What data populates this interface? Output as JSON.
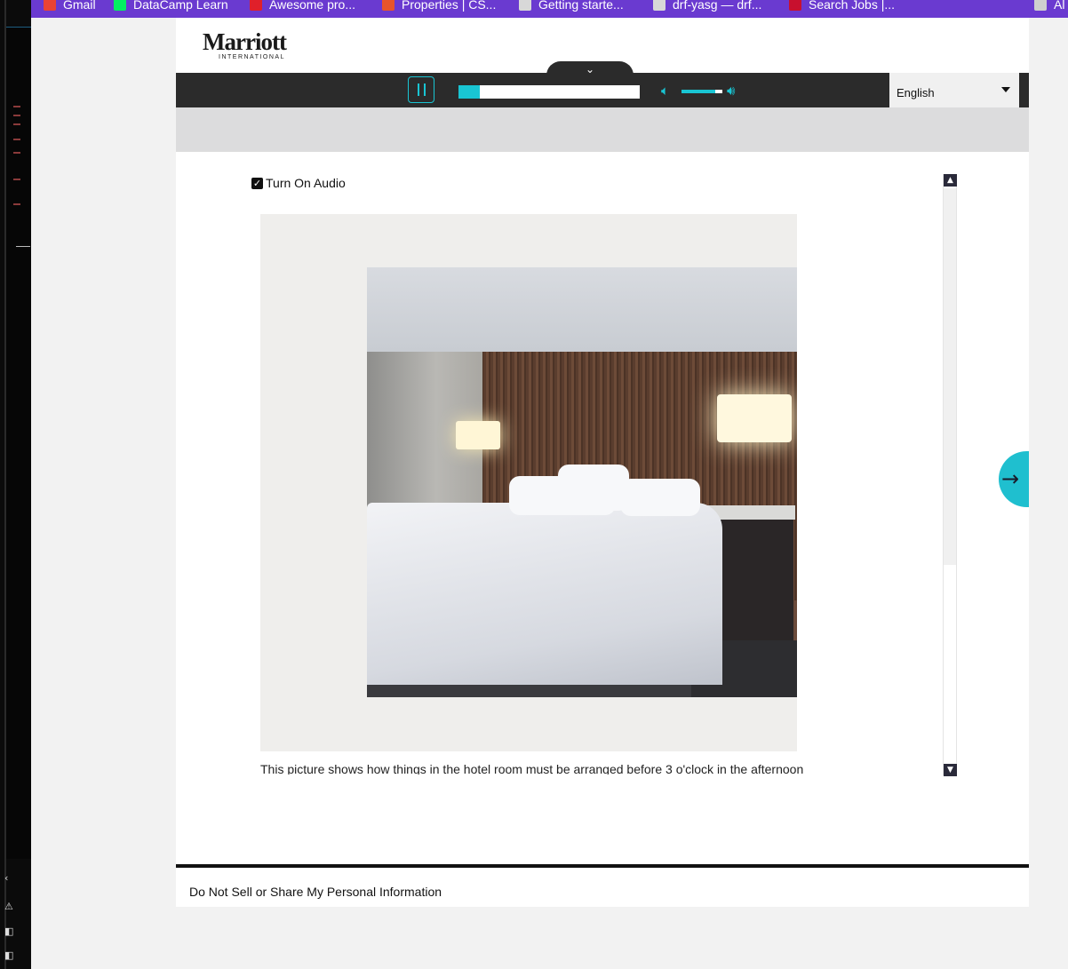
{
  "bookmarks_bar": {
    "items": [
      {
        "label": "Gmail",
        "icon": "gmail-icon",
        "color": "#ea4335"
      },
      {
        "label": "DataCamp Learn",
        "icon": "datacamp-icon",
        "color": "#03ef62"
      },
      {
        "label": "Awesome pro...",
        "icon": "awesome-icon",
        "color": "#e0202a"
      },
      {
        "label": "Properties | CS...",
        "icon": "asterisk-icon",
        "color": "#e8542a"
      },
      {
        "label": "Getting starte...",
        "icon": "doc-icon",
        "color": "#d8d8d8"
      },
      {
        "label": "drf-yasg — drf...",
        "icon": "doc-icon",
        "color": "#d8d8d8"
      },
      {
        "label": "Search Jobs |...",
        "icon": "jobs-icon",
        "color": "#c8102e"
      },
      {
        "label": "Al",
        "icon": "folder-icon",
        "color": "#cfcfcf"
      }
    ]
  },
  "brand": {
    "logo_word": "Marriott",
    "logo_sub": "INTERNATIONAL"
  },
  "player": {
    "progress_fraction": 0.12,
    "volume_fraction": 0.82,
    "accent_color": "#19c5d3",
    "language": "English"
  },
  "content": {
    "audio_toggle_label": "Turn On Audio",
    "audio_checked": true,
    "caption": "This picture shows how things in the hotel room must be arranged before 3 o'clock in the afternoon"
  },
  "footer": {
    "link": "Do Not Sell or Share My Personal Information"
  }
}
